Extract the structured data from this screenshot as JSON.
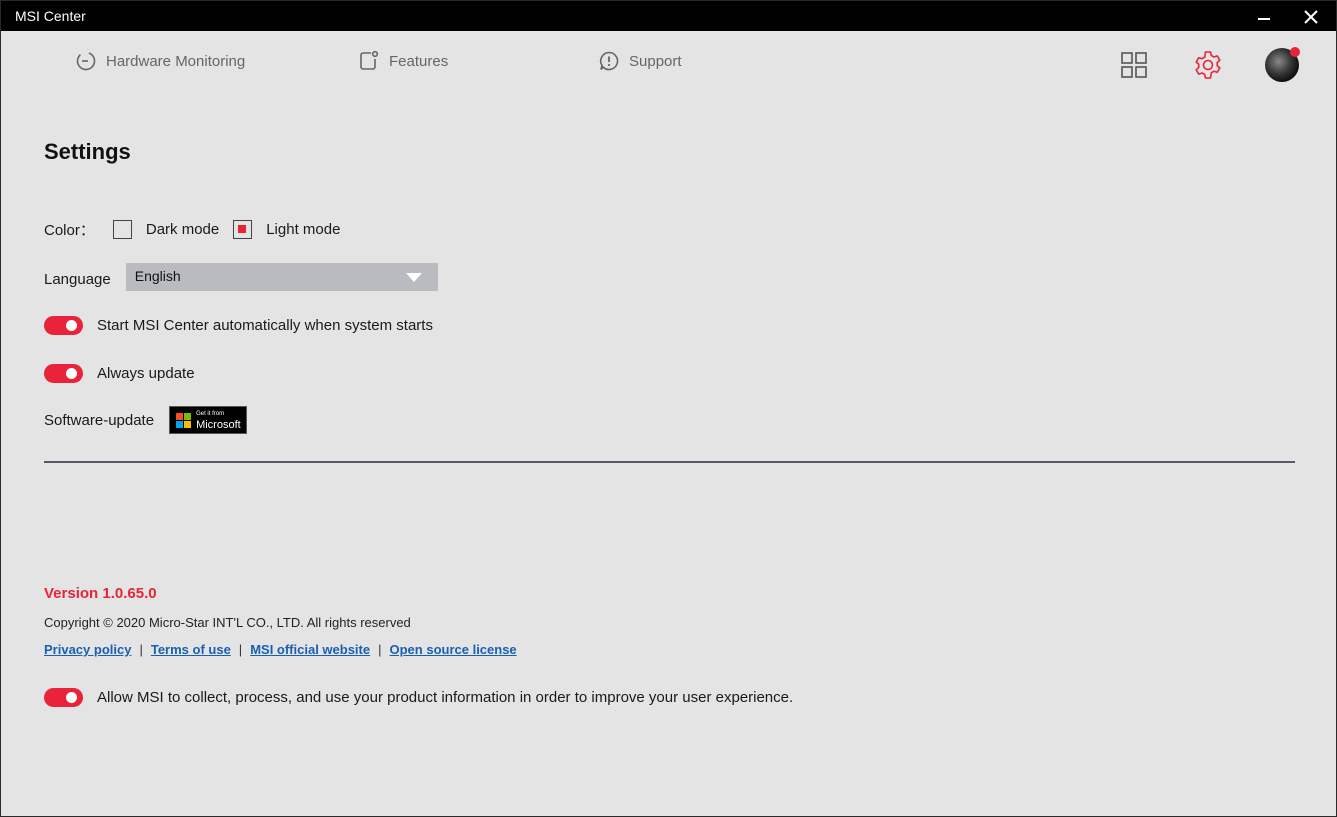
{
  "window": {
    "title": "MSI Center"
  },
  "nav": {
    "hardware_monitoring": "Hardware Monitoring",
    "features": "Features",
    "support": "Support"
  },
  "icons": {
    "grid": "grid-icon",
    "settings": "gear-icon",
    "avatar": "avatar",
    "notification": "notification-dot"
  },
  "colors": {
    "accent": "#e8233a",
    "link": "#1a5fb4",
    "background": "#e4e4e4"
  },
  "settings": {
    "title": "Settings",
    "color_label": "Color：",
    "dark_mode": "Dark mode",
    "light_mode": "Light mode",
    "selected_mode": "Light mode",
    "language_label": "Language",
    "language_value": "English",
    "auto_start": "Start MSI Center automatically when system starts",
    "auto_start_on": true,
    "always_update": "Always update",
    "always_update_on": true,
    "software_update": "Software-update",
    "ms_badge_top": "Get it from",
    "ms_badge_name": "Microsoft"
  },
  "footer": {
    "version": "Version 1.0.65.0",
    "copyright": "Copyright © 2020 Micro-Star INT'L CO., LTD. All rights reserved",
    "links": [
      "Privacy policy",
      "Terms of use",
      "MSI official website",
      "Open source license"
    ],
    "separator": "|",
    "allow_collect": "Allow MSI to collect, process, and use your product information in order to improve your user experience.",
    "allow_collect_on": true
  }
}
